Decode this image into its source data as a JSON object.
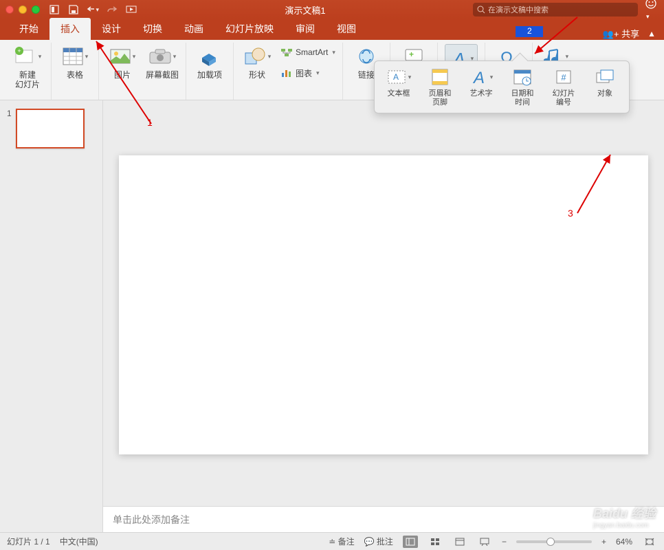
{
  "window": {
    "title": "演示文稿1"
  },
  "search": {
    "placeholder": "在演示文稿中搜索"
  },
  "tabs": {
    "items": [
      "开始",
      "插入",
      "设计",
      "切换",
      "动画",
      "幻灯片放映",
      "审阅",
      "视图"
    ],
    "active_index": 1
  },
  "share": {
    "label": "共享"
  },
  "ribbon": {
    "new_slide": "新建\n幻灯片",
    "table": "表格",
    "picture": "图片",
    "screenshot": "屏幕截图",
    "addin": "加载项",
    "shapes": "形状",
    "smartart": "SmartArt",
    "chart": "图表",
    "link": "链接",
    "comment": "批注",
    "text": "文本",
    "symbol": "符号",
    "media": "媒体"
  },
  "text_dropdown": {
    "textbox": "文本框",
    "header_footer": "页眉和\n页脚",
    "wordart": "艺术字",
    "datetime": "日期和\n时间",
    "slide_number": "幻灯片\n编号",
    "object": "对象"
  },
  "thumbnails": {
    "items": [
      {
        "num": "1"
      }
    ]
  },
  "notes": {
    "placeholder": "单击此处添加备注"
  },
  "status": {
    "slide_count": "幻灯片 1 / 1",
    "language": "中文(中国)",
    "notes_btn": "备注",
    "comments_btn": "批注",
    "zoom": "64%"
  },
  "annotations": {
    "a1": "1",
    "a2": "2",
    "a3": "3"
  },
  "watermark": {
    "brand": "Baidu 经验",
    "url": "jingyan.baidu.com"
  }
}
